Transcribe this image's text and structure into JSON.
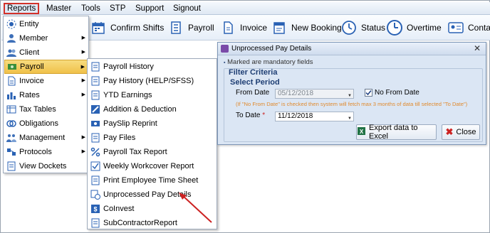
{
  "menubar": {
    "items": [
      "Reports",
      "Master",
      "Tools",
      "STP",
      "Support",
      "Signout"
    ]
  },
  "toolbar": {
    "confirm_shifts": "Confirm Shifts",
    "payroll": "Payroll",
    "invoice": "Invoice",
    "new_booking": "New Booking",
    "status": "Status",
    "overtime": "Overtime",
    "contact": "Conta"
  },
  "reports_menu": {
    "items": [
      "Entity",
      "Member",
      "Client",
      "Payroll",
      "Invoice",
      "Rates",
      "Tax Tables",
      "Obligations",
      "Management",
      "Protocols",
      "View Dockets"
    ]
  },
  "payroll_menu": {
    "items": [
      "Payroll History",
      "Pay History (HELP/SFSS)",
      "YTD Earnings",
      "Addition & Deduction",
      "PaySlip Reprint",
      "Pay Files",
      "Payroll Tax Report",
      "Weekly Workcover Report",
      "Print Employee Time Sheet",
      "Unprocessed Pay Details",
      "CoInvest",
      "SubContractorReport"
    ]
  },
  "dialog": {
    "title": "Unprocessed Pay Details",
    "mandatory_note": "Marked are mandatory fields",
    "filter_criteria": "Filter Criteria",
    "select_period": "Select Period",
    "from_date_label": "From Date",
    "from_date_value": "05/12/2018",
    "no_from_date_label": "No From Date",
    "no_from_date_checked": true,
    "hint": "(If \"No From Date\" is checked then system will fetch max 3 months of data till selected \"To Date\")",
    "to_date_label": "To Date",
    "required_mark": "*",
    "to_date_value": "11/12/2018",
    "export_button": "Export data to Excel",
    "close_button": "Close"
  },
  "colors": {
    "highlight_border": "#d3322a",
    "menu_highlight": "#f0c14a",
    "hint_text": "#e08a2e",
    "heading_text": "#1f3f74",
    "arrow": "#cc2222"
  }
}
